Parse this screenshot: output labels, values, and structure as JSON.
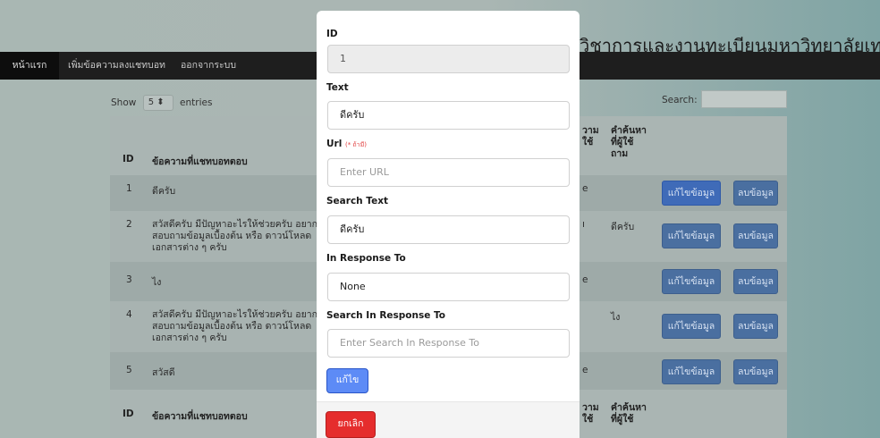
{
  "site": {
    "title": "วิชาการและงานทะเบียนมหาวิทยาลัยเทค"
  },
  "nav": {
    "home": "หน้าแรก",
    "add": "เพิ่มข้อความลงแชทบอท",
    "logout": "ออกจากระบบ"
  },
  "table_controls": {
    "show": "Show",
    "entries_value": "5",
    "entries": "entries",
    "search": "Search:"
  },
  "table": {
    "headers": {
      "id": "ID",
      "message": "ข้อความที่แชทบอทตอบ",
      "question_partial": "วาม\nใช้",
      "search_word": "คำค้นหา\nที่ผู้ใช้\nถาม"
    },
    "footer_headers": {
      "id": "ID",
      "message": "ข้อความที่แชทบอทตอบ",
      "question_partial": "วาม\nใช้",
      "search_word": "คำค้นหา\nที่ผู้ใช้"
    },
    "rows": [
      {
        "id": "1",
        "message": "ดีครับ",
        "partial": "e",
        "search": ""
      },
      {
        "id": "2",
        "message": "สวัสดีครับ มีปัญหาอะไรให้ช่วยครับ อยาก\nสอบถามข้อมูลเบื้องต้น หรือ ดาวน์โหลด\nเอกสารต่าง ๆ ครับ",
        "partial": "ı",
        "search": "ดีครับ"
      },
      {
        "id": "3",
        "message": "ไง",
        "partial": "e",
        "search": ""
      },
      {
        "id": "4",
        "message": "สวัสดีครับ มีปัญหาอะไรให้ช่วยครับ อยาก\nสอบถามข้อมูลเบื้องต้น หรือ ดาวน์โหลด\nเอกสารต่าง ๆ ครับ",
        "partial": "",
        "search": "ไง"
      },
      {
        "id": "5",
        "message": "สวัสดี",
        "partial": "e",
        "search": ""
      }
    ],
    "edit_label": "แก้ไขข้อมูล",
    "delete_label": "ลบข้อมูล"
  },
  "modal": {
    "id_label": "ID",
    "id_value": "1",
    "text_label": "Text",
    "text_value": "ดีครับ",
    "url_label": "Url",
    "url_required": "(* ถ้ามี)",
    "url_placeholder": "Enter URL",
    "search_text_label": "Search Text",
    "search_text_value": "ดีครับ",
    "in_response_label": "In Response To",
    "in_response_value": "None",
    "search_in_response_label": "Search In Response To",
    "search_in_response_placeholder": "Enter Search In Response To",
    "save_label": "แก้ไข",
    "cancel_label": "ยกเลิก"
  },
  "colors": {
    "primary": "#5d8bf6",
    "danger": "#e52d2d",
    "navbar": "#1e1e1e"
  }
}
